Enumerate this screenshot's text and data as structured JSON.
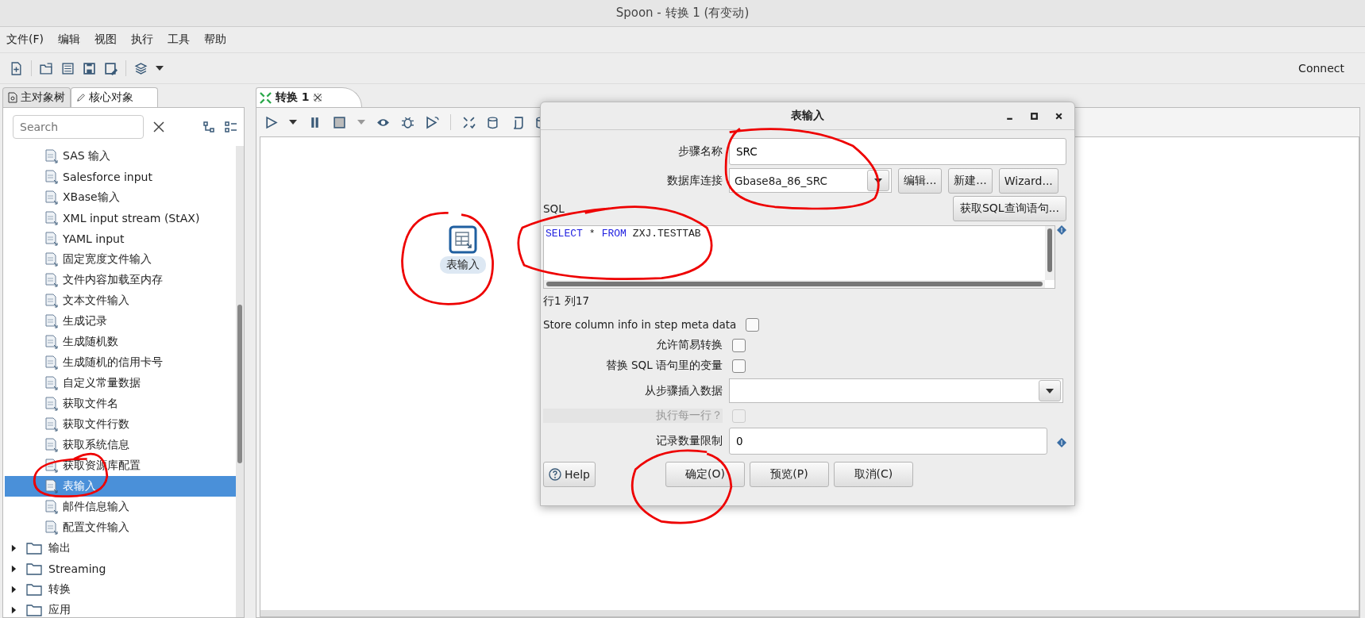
{
  "window": {
    "title": "Spoon - 转换 1 (有变动)"
  },
  "menu": [
    "文件(F)",
    "编辑",
    "视图",
    "执行",
    "工具",
    "帮助"
  ],
  "toolbar": {
    "connect": "Connect"
  },
  "left_panel": {
    "tabs": [
      {
        "label": "主对象树",
        "selected": false
      },
      {
        "label": "核心对象",
        "selected": true
      }
    ],
    "search": {
      "placeholder": "Search"
    },
    "steps": [
      {
        "label": "SAS 输入",
        "selected": false
      },
      {
        "label": "Salesforce input",
        "selected": false
      },
      {
        "label": "XBase输入",
        "selected": false
      },
      {
        "label": "XML input stream (StAX)",
        "selected": false
      },
      {
        "label": "YAML input",
        "selected": false
      },
      {
        "label": "固定宽度文件输入",
        "selected": false
      },
      {
        "label": "文件内容加载至内存",
        "selected": false
      },
      {
        "label": "文本文件输入",
        "selected": false
      },
      {
        "label": "生成记录",
        "selected": false
      },
      {
        "label": "生成随机数",
        "selected": false
      },
      {
        "label": "生成随机的信用卡号",
        "selected": false
      },
      {
        "label": "自定义常量数据",
        "selected": false
      },
      {
        "label": "获取文件名",
        "selected": false
      },
      {
        "label": "获取文件行数",
        "selected": false
      },
      {
        "label": "获取系统信息",
        "selected": false
      },
      {
        "label": "获取资源库配置",
        "selected": false
      },
      {
        "label": "表输入",
        "selected": true
      },
      {
        "label": "邮件信息输入",
        "selected": false
      },
      {
        "label": "配置文件输入",
        "selected": false
      }
    ],
    "folders": [
      {
        "label": "输出",
        "expanded": false
      },
      {
        "label": "Streaming",
        "expanded": false
      },
      {
        "label": "转换",
        "expanded": false
      },
      {
        "label": "应用",
        "expanded": false
      }
    ]
  },
  "editor": {
    "tabs": [
      {
        "label": "转换 1",
        "selected": true
      }
    ],
    "canvas": {
      "steps": [
        {
          "label": "表输入"
        }
      ]
    }
  },
  "dialog": {
    "title": "表输入",
    "step_name": {
      "label": "步骤名称",
      "value": "SRC"
    },
    "connection": {
      "label": "数据库连接",
      "value": "Gbase8a_86_SRC",
      "buttons": [
        "编辑...",
        "新建...",
        "Wizard..."
      ]
    },
    "sql": {
      "label": "SQL",
      "button": "获取SQL查询语句...",
      "tokens": [
        {
          "kind": "keyword",
          "text": "SELECT"
        },
        {
          "kind": "plain",
          "text": "*"
        },
        {
          "kind": "keyword",
          "text": "FROM"
        },
        {
          "kind": "plain",
          "text": "ZXJ.TESTTAB"
        }
      ]
    },
    "cursor": "行1 列17",
    "fields": [
      {
        "kind": "checkbox",
        "label": "Store column info in step meta data",
        "checked": false,
        "disabled": false
      },
      {
        "kind": "checkbox",
        "label": "允许简易转换",
        "checked": false,
        "disabled": false
      },
      {
        "kind": "checkbox",
        "label": "替换 SQL 语句里的变量",
        "checked": false,
        "disabled": false
      },
      {
        "kind": "combo",
        "label": "从步骤插入数据"
      },
      {
        "kind": "checkbox",
        "label": "执行每一行？",
        "checked": false,
        "disabled": true
      },
      {
        "kind": "variable_text",
        "label": "记录数量限制",
        "value": "0"
      }
    ],
    "buttons": [
      {
        "kind": "help",
        "label": "Help"
      },
      {
        "kind": "plain",
        "label": "确定(O)"
      },
      {
        "kind": "plain",
        "label": "预览(P)"
      },
      {
        "kind": "plain",
        "label": "取消(C)"
      }
    ]
  }
}
